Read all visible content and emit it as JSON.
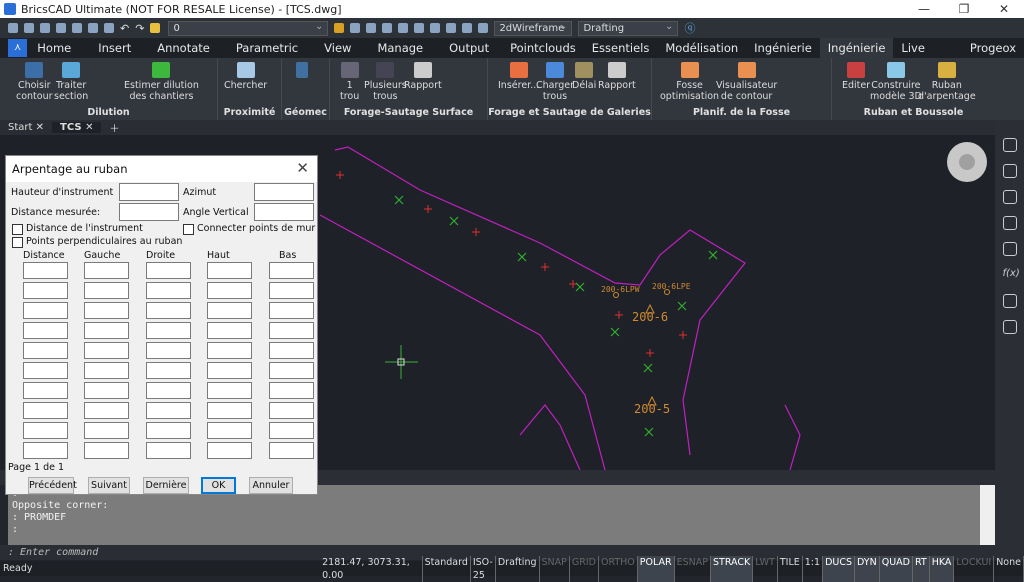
{
  "title": "BricsCAD Ultimate (NOT FOR RESALE License) - [TCS.dwg]",
  "qat": {
    "layer": "0",
    "visualstyle": "2dWireframe",
    "workspace": "Drafting"
  },
  "ribbon_tabs": [
    "Home",
    "Insert",
    "Annotate",
    "Parametric",
    "View",
    "Manage",
    "Output",
    "Pointclouds",
    "Essentiels",
    "Modélisation",
    "Ingénierie 1",
    "Ingénierie 2",
    "Live Survey",
    "Progeox"
  ],
  "active_tab": "Ingénierie 2",
  "panels": [
    {
      "title": "Dilution",
      "buttons": [
        "Choisir\ncontour",
        "Traiter\nsection",
        "Estimer dilution\ndes chantiers"
      ]
    },
    {
      "title": "Proximité",
      "buttons": [
        "Chercher"
      ]
    },
    {
      "title": "Géomec",
      "buttons": []
    },
    {
      "title": "Forage-Sautage Surface",
      "buttons": [
        "1\ntrou",
        "Plusieurs\ntrous",
        "Rapport"
      ]
    },
    {
      "title": "Forage et Sautage de Galeries",
      "buttons": [
        "Insérer...",
        "Charger\ntrous",
        "Délai",
        "Rapport"
      ]
    },
    {
      "title": "Planif. de la Fosse",
      "buttons": [
        "Fosse\noptimisation",
        "Visualisateur\nde contour"
      ]
    },
    {
      "title": "Ruban et Boussole",
      "buttons": [
        "Editer",
        "Construire\nmodèle 3D",
        "Ruban\nd'arpentage"
      ]
    }
  ],
  "doc_tabs": [
    "Start",
    "TCS"
  ],
  "drawing": {
    "labels": [
      "200-6LPW",
      "200-6LPE",
      "200-6",
      "200-5"
    ],
    "colors": {
      "boundary": "#c020c0",
      "red_marker": "#e03030",
      "green_marker": "#30b030",
      "label": "#d08a30"
    }
  },
  "dialog": {
    "title": "Arpentage au ruban",
    "fields": {
      "hauteur": "Hauteur d'instrument",
      "azimut": "Azimut",
      "distance": "Distance mesurée:",
      "angle": "Angle Vertical"
    },
    "checkboxes": {
      "dist_instr": "Distance de l'instrument",
      "connect": "Connecter points de mur",
      "perp": "Points perpendiculaires au ruban"
    },
    "columns": [
      "Distance",
      "Gauche",
      "Droite",
      "Haut",
      "Bas"
    ],
    "page": "Page 1 de 1",
    "buttons": [
      "Précédent",
      "Suivant",
      "Dernière",
      "OK",
      "Annuler"
    ]
  },
  "command": {
    "history": ":\nOpposite corner:\n: PROMDEF\n:",
    "prompt": ": Enter command"
  },
  "status": {
    "ready": "Ready",
    "coords": "2181.47, 3073.31, 0.00",
    "items": [
      [
        "Standard",
        "n"
      ],
      [
        "ISO-25",
        "n"
      ],
      [
        "Drafting",
        "n"
      ],
      [
        "SNAP",
        "off"
      ],
      [
        "GRID",
        "off"
      ],
      [
        "ORTHO",
        "off"
      ],
      [
        "POLAR",
        "on"
      ],
      [
        "ESNAP",
        "off"
      ],
      [
        "STRACK",
        "on"
      ],
      [
        "LWT",
        "off"
      ],
      [
        "TILE",
        "n"
      ],
      [
        "1:1",
        "n"
      ],
      [
        "DUCS",
        "on"
      ],
      [
        "DYN",
        "on"
      ],
      [
        "QUAD",
        "on"
      ],
      [
        "RT",
        "on"
      ],
      [
        "HKA",
        "on"
      ],
      [
        "LOCKUI",
        "off"
      ],
      [
        "None",
        "n"
      ]
    ]
  }
}
